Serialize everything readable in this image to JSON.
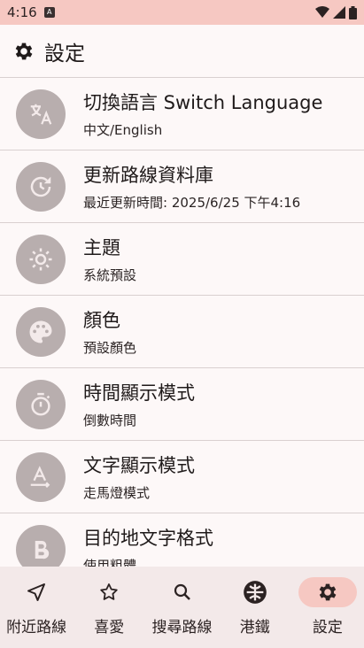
{
  "status": {
    "time": "4:16"
  },
  "header": {
    "title": "設定"
  },
  "settings": [
    {
      "title": "切換語言 Switch Language",
      "subtitle": "中文/English",
      "icon": "translate-icon"
    },
    {
      "title": "更新路線資料庫",
      "subtitle": "最近更新時間: 2025/6/25 下午4:16",
      "icon": "update-icon"
    },
    {
      "title": "主題",
      "subtitle": "系統預設",
      "icon": "sun-icon"
    },
    {
      "title": "顏色",
      "subtitle": "預設顏色",
      "icon": "palette-icon"
    },
    {
      "title": "時間顯示模式",
      "subtitle": "倒數時間",
      "icon": "timer-icon"
    },
    {
      "title": "文字顯示模式",
      "subtitle": "走馬燈模式",
      "icon": "text-format-icon"
    },
    {
      "title": "目的地文字格式",
      "subtitle": "使用粗體",
      "icon": "bold-icon"
    }
  ],
  "nav": [
    {
      "label": "附近路線",
      "icon": "navigation-arrow-icon"
    },
    {
      "label": "喜愛",
      "icon": "star-icon"
    },
    {
      "label": "搜尋路線",
      "icon": "search-icon"
    },
    {
      "label": "港鐵",
      "icon": "mtr-logo-icon"
    },
    {
      "label": "設定",
      "icon": "gear-icon",
      "active": true
    }
  ],
  "colors": {
    "accent": "#f6c8c2",
    "icon_circle": "#b8aeae",
    "background": "#fdf8f8",
    "nav_bg": "#f3e9e9"
  }
}
